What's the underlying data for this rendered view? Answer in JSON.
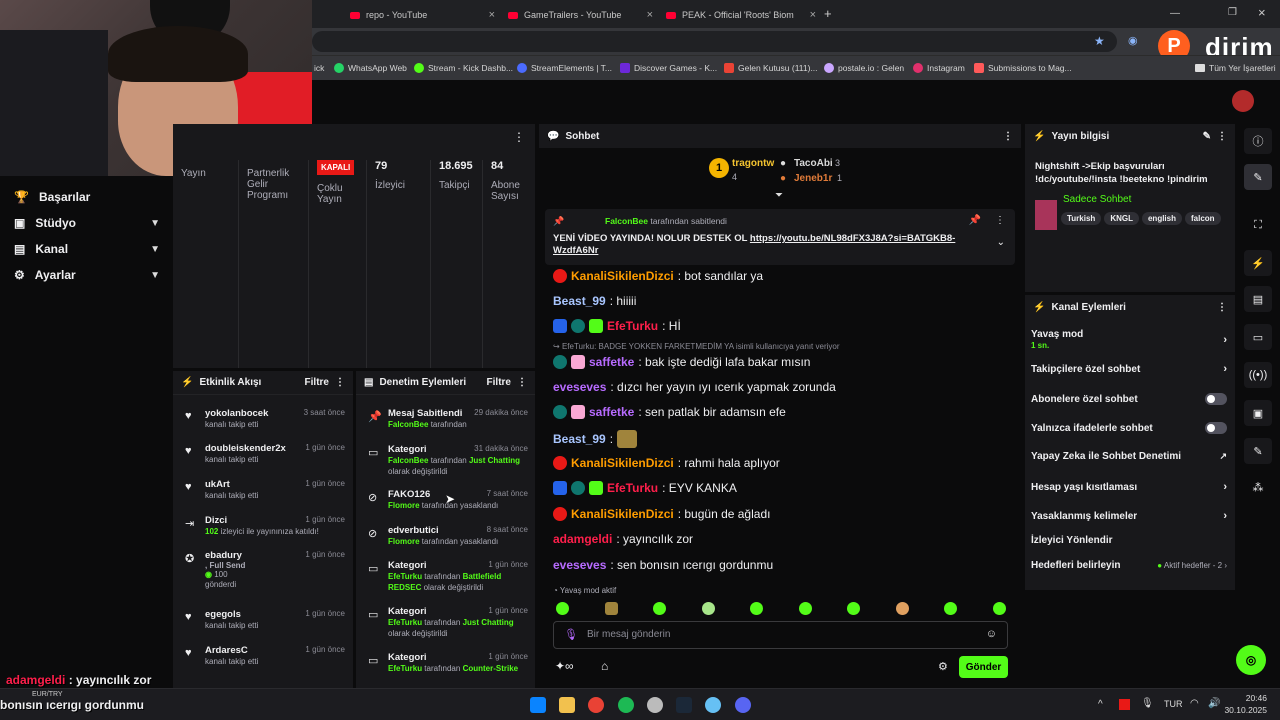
{
  "browser": {
    "tabs": [
      {
        "label": "repo - YouTube"
      },
      {
        "label": "GameTrailers - YouTube"
      },
      {
        "label": "PEAK - Official 'Roots' Biome U"
      }
    ],
    "new_tab": "+",
    "bookmarks": [
      "ick",
      "WhatsApp Web",
      "Stream - Kick Dashb...",
      "StreamElements | T...",
      "Discover Games - K...",
      "Gelen Kutusu (111)...",
      "postale.io : Gelen",
      "Instagram",
      "Submissions to Mag...",
      "Tüm Yer İşaretleri"
    ],
    "watermark": "dirim"
  },
  "nav": {
    "items": [
      {
        "label": "Başarılar"
      },
      {
        "label": "Stüdyo"
      },
      {
        "label": "Kanal"
      },
      {
        "label": "Ayarlar"
      }
    ]
  },
  "stats": {
    "cols": [
      {
        "value": "",
        "label": "Yayın"
      },
      {
        "value": "",
        "label": "Partnerlik Gelir Programı"
      },
      {
        "value": "KAPALI",
        "label": "Çoklu Yayın"
      },
      {
        "value": "79",
        "label": "İzleyici"
      },
      {
        "value": "18.695",
        "label": "Takipçi"
      },
      {
        "value": "84",
        "label": "Abone Sayısı"
      }
    ]
  },
  "feed": {
    "title": "Etkinlik Akışı",
    "filter": "Filtre",
    "rows": [
      {
        "name": "yokolanbocek",
        "sub": "kanalı takip etti",
        "time": "3 saat önce"
      },
      {
        "name": "doubleiskender2x",
        "sub": "kanalı takip etti",
        "time": "1 gün önce"
      },
      {
        "name": "ukArt",
        "sub": "kanalı takip etti",
        "time": "1 gün önce"
      },
      {
        "name": "Dizci",
        "sub_a": "102",
        "sub": " izleyici ile yayınınıza katıldı!",
        "time": "1 gün önce"
      },
      {
        "name": "ebadury",
        "sub_a": ", Full Send",
        "sub_b": "100",
        "sub": "gönderdi",
        "time": "1 gün önce"
      },
      {
        "name": "egegols",
        "sub": "kanalı takip etti",
        "time": "1 gün önce"
      },
      {
        "name": "ArdaresC",
        "sub": "kanalı takip etti",
        "time": "1 gün önce"
      }
    ]
  },
  "mod": {
    "title": "Denetim Eylemleri",
    "filter": "Filtre",
    "rows": [
      {
        "name": "Mesaj Sabitlendi",
        "time": "29 dakika önce",
        "who": "FalconBee",
        "mid": " tarafından",
        "what": "",
        "end": ""
      },
      {
        "name": "Kategori",
        "time": "31 dakika önce",
        "who": "FalconBee",
        "mid": " tarafından ",
        "what": "Just Chatting",
        "end": "olarak değiştirildi"
      },
      {
        "name": "FAKO126",
        "time": "7 saat önce",
        "who": "Flomore",
        "mid": " tarafından yasaklandı",
        "what": "",
        "end": ""
      },
      {
        "name": "edverbutici",
        "time": "8 saat önce",
        "who": "Flomore",
        "mid": " tarafından yasaklandı",
        "what": "",
        "end": ""
      },
      {
        "name": "Kategori",
        "time": "1 gün önce",
        "who": "EfeTurku",
        "mid": " tarafından ",
        "what": "Battlefield REDSEC",
        "end": " olarak değiştirildi"
      },
      {
        "name": "Kategori",
        "time": "1 gün önce",
        "who": "EfeTurku",
        "mid": " tarafından ",
        "what": "Just Chatting",
        "end": "olarak değiştirildi"
      },
      {
        "name": "Kategori",
        "time": "1 gün önce",
        "who": "EfeTurku",
        "mid": " tarafından ",
        "what": "Counter-Strike",
        "end": ""
      }
    ]
  },
  "chat": {
    "title": "Sohbet",
    "top": [
      {
        "name": "tragontw",
        "count": "4"
      },
      {
        "name": "TacoAbi",
        "count": "3"
      },
      {
        "name": "Jeneb1r",
        "count": "1"
      }
    ],
    "pinned": {
      "by": "FalconBee",
      "by_suffix": " tarafından sabitlendi",
      "text": "YENİ VİDEO YAYINDA! NOLUR DESTEK OL ",
      "link": "https://youtu.be/NL98dFX3J8A?si=BATGKB8-WzdfA6Nr"
    },
    "reply_note": "EfeTurku: BADGE YOKKEN FARKETMEDİM YA isimli kullanıcıya yanıt veriyor",
    "messages": [
      {
        "user": "KanaliSikilenDizci",
        "text": ": bot sandılar ya",
        "color": "#ff9d00"
      },
      {
        "user": "Beast_99",
        "text": ": hiiiii",
        "color": "#a9c6ff"
      },
      {
        "user": "EfeTurku",
        "text": ": Hİ",
        "color": "#ff1f4b"
      },
      {
        "user": "saffetke",
        "text": ": bak işte dediği lafa bakar mısın",
        "color": "#b76bff"
      },
      {
        "user": "eveseves",
        "text": ": dızcı her yayın ıyı ıcerık yapmak zorunda",
        "color": "#b76bff"
      },
      {
        "user": "saffetke",
        "text": ": sen patlak bir adamsın efe",
        "color": "#b76bff"
      },
      {
        "user": "Beast_99",
        "text": ":",
        "color": "#a9c6ff"
      },
      {
        "user": "KanaliSikilenDizci",
        "text": ": rahmi hala aplıyor",
        "color": "#ff9d00"
      },
      {
        "user": "EfeTurku",
        "text": ": EYV KANKA",
        "color": "#ff1f4b"
      },
      {
        "user": "KanaliSikilenDizci",
        "text": ": bugün de ağladı",
        "color": "#ff9d00"
      },
      {
        "user": "adamgeldi",
        "text": ": yayıncılık zor",
        "color": "#ff1f4b"
      },
      {
        "user": "eveseves",
        "text": ": sen bonısın ıcerıgı gordunmu",
        "color": "#b76bff"
      }
    ],
    "slow_note": "Yavaş mod aktif",
    "input_placeholder": "Bir mesaj gönderin",
    "send": "Gönder"
  },
  "info": {
    "title": "Yayın bilgisi",
    "stream_title": "Nightshift ->Ekip başvuruları !dc/youtube/!insta !beetekno !pindirim",
    "category": "Sadece Sohbet",
    "tags": [
      "Turkish",
      "KNGL",
      "english",
      "falcon"
    ]
  },
  "actions": {
    "title": "Kanal Eylemleri",
    "rows": [
      {
        "label": "Yavaş mod",
        "sub": "1 sn."
      },
      {
        "label": "Takipçilere özel sohbet"
      },
      {
        "label": "Abonelere özel sohbet"
      },
      {
        "label": "Yalnızca ifadelerle sohbet"
      },
      {
        "label": "Yapay Zeka ile Sohbet Denetimi"
      },
      {
        "label": "Hesap yaşı kısıtlaması"
      },
      {
        "label": "Yasaklanmış kelimeler"
      },
      {
        "label": "İzleyici Yönlendir"
      },
      {
        "label": "Hedefleri belirleyin",
        "sub": "Aktif hedefler - 2"
      }
    ]
  },
  "overlay": {
    "user": "adamgeldi",
    "line1": " : yayıncılık zor",
    "line2": "bonısın ıcerıgı gordunmu",
    "ticker": "EUR/TRY"
  },
  "taskbar": {
    "lang": "TUR",
    "time": "20:46",
    "date": "30.10.2025"
  },
  "colors": {
    "kick_green": "#53fc18",
    "panel": "#18181b",
    "bg": "#0b0b0c",
    "danger": "#e91916"
  }
}
